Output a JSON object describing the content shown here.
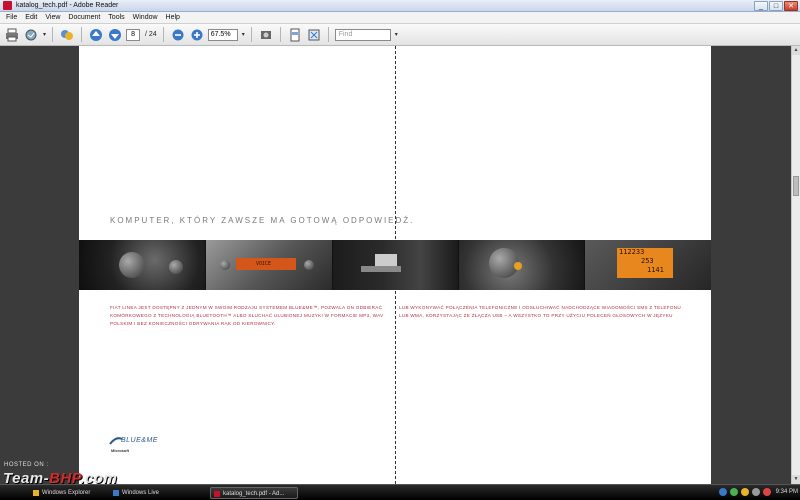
{
  "window": {
    "title": "katalog_tech.pdf - Adobe Reader",
    "controls": {
      "minimize": "_",
      "maximize": "□",
      "close": "✕"
    }
  },
  "menu": [
    "File",
    "Edit",
    "View",
    "Document",
    "Tools",
    "Window",
    "Help"
  ],
  "toolbar": {
    "page_current": "8",
    "page_total": "/ 24",
    "zoom": "67.5%",
    "find_placeholder": "Find"
  },
  "document": {
    "heading": "KOMPUTER, KTÓRY ZAWSZE MA GOTOWĄ ODPOWIEDŹ.",
    "voice_display": "VOICE",
    "dash_display_top": "112233",
    "dash_display_mid": "253",
    "dash_display_bot": "1141",
    "body_left": "FIAT LINEA JEST DOSTĘPNY Z JEDNYM W SWOIM RODZAJU SYSTEMEM BLUE&ME™, POZWALA ON ODBIERAĆ KOMÓRKOWEGO Z TECHNOLOGIĄ BLUETOOTH™ ALBO SŁUCHAĆ ULUBIONEJ MUZYKI W FORMACIE MP3, WAV POLSKIM I BEZ KONIECZNOŚCI ODRYWANIA RĄK OD KIEROWNICY.",
    "body_right": "LUB WYKONYWAĆ POŁĄCZENIA TELEFONICZNE I ODSŁUCHIWAĆ NADCHODZĄCE WIADOMOŚCI SMS Z TELEFONU LUB WMA, KORZYSTAJĄC ZE ZŁĄCZA USB – A WSZYSTKO TO PRZY UŻYCIU POLECEŃ GŁOSOWYCH W JĘZYKU",
    "logo_text": "BLUE&ME",
    "logo_sub": "Microsoft"
  },
  "watermark": {
    "hosted": "HOSTED ON :",
    "team": "Team-",
    "bhp": "BHP",
    "com": ".com"
  },
  "taskbar": {
    "tasks": [
      "Windows Explorer",
      "Windows Live",
      "katalog_tech.pdf - Ad..."
    ],
    "clock": "9:34 PM"
  },
  "colors": {
    "accent_red": "#b2303c",
    "reader_red": "#c8102e",
    "heading_gray": "#7a7a7a"
  }
}
